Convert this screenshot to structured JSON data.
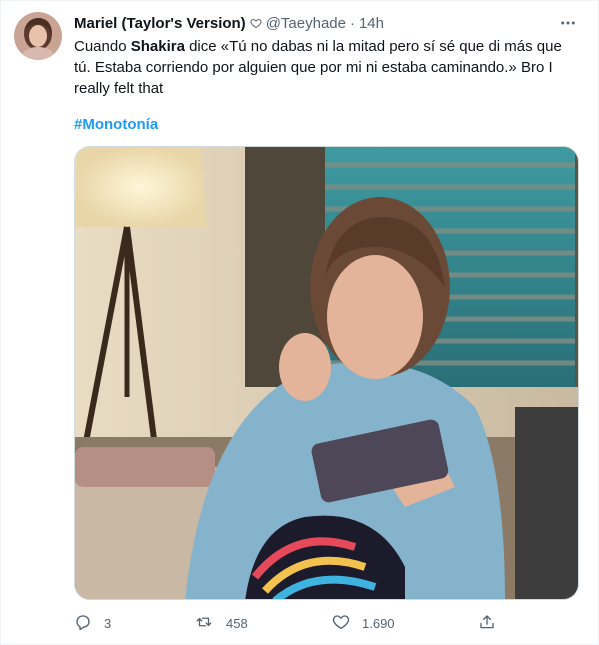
{
  "user": {
    "display_name": "Mariel (Taylor's Version)",
    "handle": "@Taeyhade",
    "separator": "·",
    "time": "14h"
  },
  "tweet": {
    "text_before": "Cuando ",
    "mention": "Shakira",
    "text_after": " dice «Tú no dabas ni la mitad pero sí sé que di más que tú. Estaba corriendo por alguien que por mi ni estaba caminando.» Bro I really felt that",
    "hashtag": "#Monotonía"
  },
  "actions": {
    "replies": "3",
    "retweets": "458",
    "likes": "1.690"
  },
  "icons": {
    "name_badge": "heart-outline-icon",
    "more": "more-horizontal-icon",
    "reply": "reply-icon",
    "retweet": "retweet-icon",
    "like": "like-icon",
    "share": "share-icon"
  },
  "colors": {
    "hashtag": "#1d9bf0",
    "secondary_text": "#536471",
    "text": "#0f1419"
  }
}
